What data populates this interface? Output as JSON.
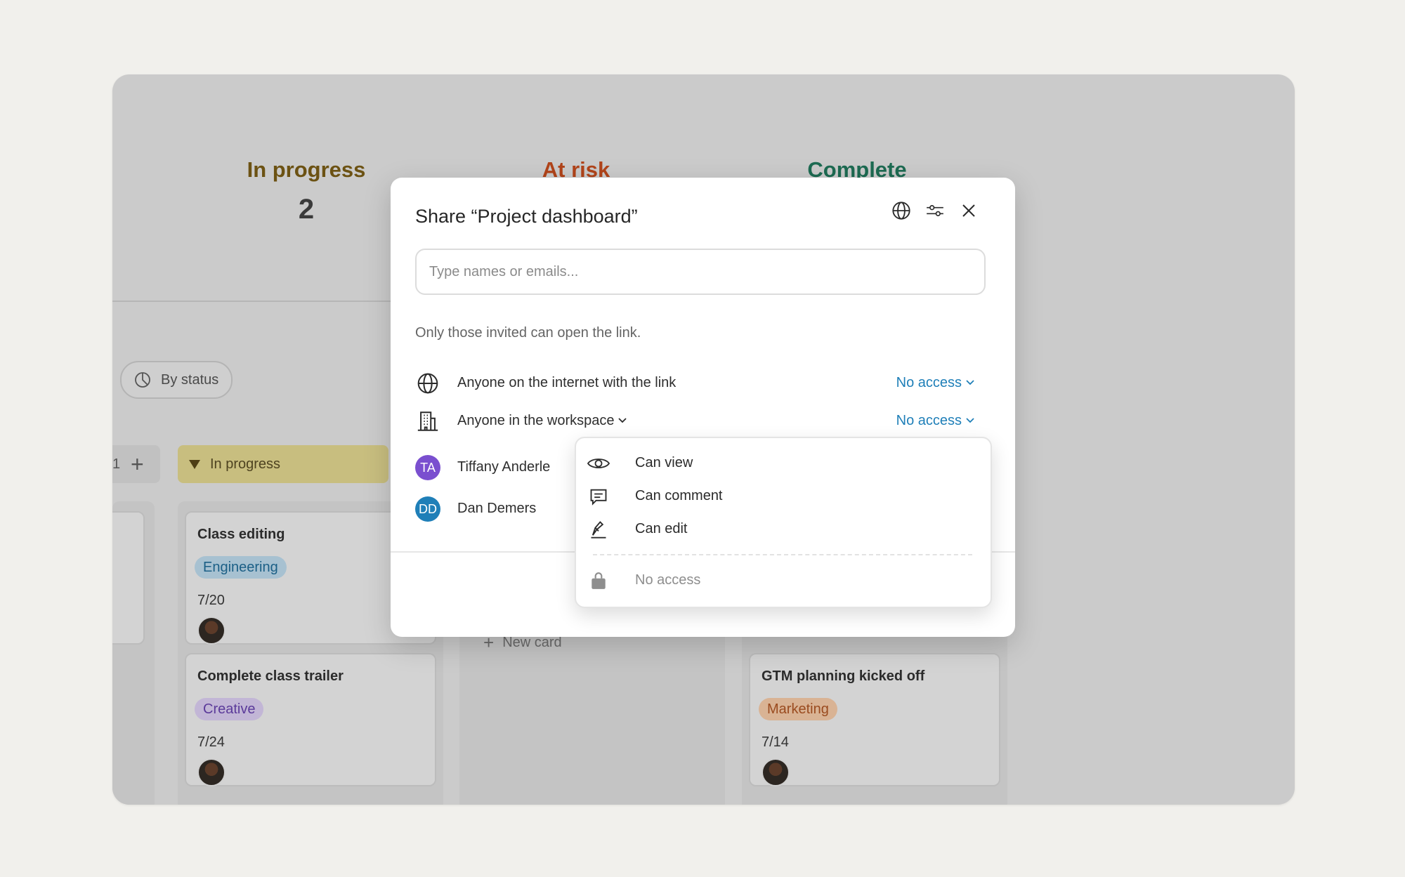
{
  "board": {
    "stats": [
      {
        "title": "In progress",
        "count": "2"
      },
      {
        "title": "At risk",
        "count": ""
      },
      {
        "title": "Complete",
        "count": ""
      }
    ],
    "group_button": "By status",
    "left_column_count": "1",
    "column_header": "In progress",
    "new_card": "New card",
    "cards": [
      {
        "title": "Class editing",
        "tag": "Engineering",
        "date": "7/20"
      },
      {
        "title": "Complete class trailer",
        "tag": "Creative",
        "date": "7/24"
      },
      {
        "title": "GTM planning kicked off",
        "tag": "Marketing",
        "date": "7/14"
      }
    ]
  },
  "modal": {
    "title": "Share “Project dashboard”",
    "input_placeholder": "Type names or emails...",
    "note": "Only those invited can open the link.",
    "rows": [
      {
        "label": "Anyone on the internet with the link",
        "access": "No access",
        "icon": "globe-icon"
      },
      {
        "label": "Anyone in the workspace",
        "access": "No access",
        "icon": "building-icon"
      }
    ],
    "people": [
      {
        "initials": "TA",
        "name": "Tiffany Anderle",
        "color": "#7a4fcf"
      },
      {
        "initials": "DD",
        "name": "Dan Demers",
        "color": "#1f7fb8"
      }
    ]
  },
  "dropdown": {
    "items": [
      {
        "label": "Can view",
        "icon": "eye-icon"
      },
      {
        "label": "Can comment",
        "icon": "comment-icon"
      },
      {
        "label": "Can edit",
        "icon": "pen-icon"
      },
      {
        "label": "No access",
        "icon": "lock-icon"
      }
    ]
  },
  "colors": {
    "accent": "#1f7fb8",
    "primary": "#7a4fcf",
    "in_progress": "#6c5213",
    "at_risk": "#b1441a",
    "complete": "#1d6b52"
  }
}
